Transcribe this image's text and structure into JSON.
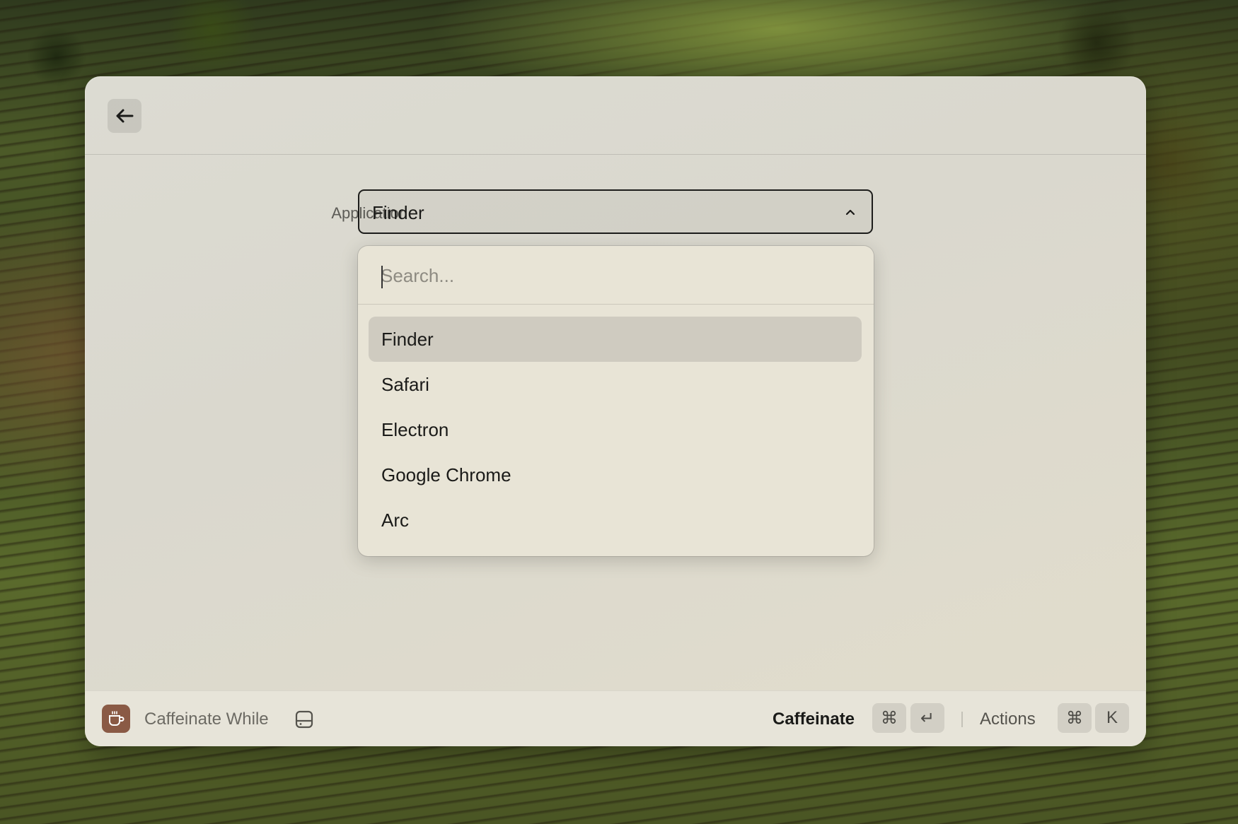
{
  "window": {
    "back_button_icon": "arrow-left-icon"
  },
  "form": {
    "application_label": "Application",
    "application_value": "Finder"
  },
  "dropdown": {
    "search_placeholder": "Search...",
    "search_value": "",
    "options": [
      {
        "label": "Finder",
        "selected": true
      },
      {
        "label": "Safari",
        "selected": false
      },
      {
        "label": "Electron",
        "selected": false
      },
      {
        "label": "Google Chrome",
        "selected": false
      },
      {
        "label": "Arc",
        "selected": false
      }
    ]
  },
  "statusbar": {
    "app_icon": "coffee-cup-icon",
    "title": "Caffeinate While",
    "mode_icon": "drive-icon",
    "primary_action": "Caffeinate",
    "primary_keys": [
      "⌘",
      "↵"
    ],
    "secondary_action": "Actions",
    "secondary_keys": [
      "⌘",
      "K"
    ]
  },
  "colors": {
    "app_icon_bg": "#8a5a45",
    "selected_option_bg": "#cfcbc0"
  }
}
